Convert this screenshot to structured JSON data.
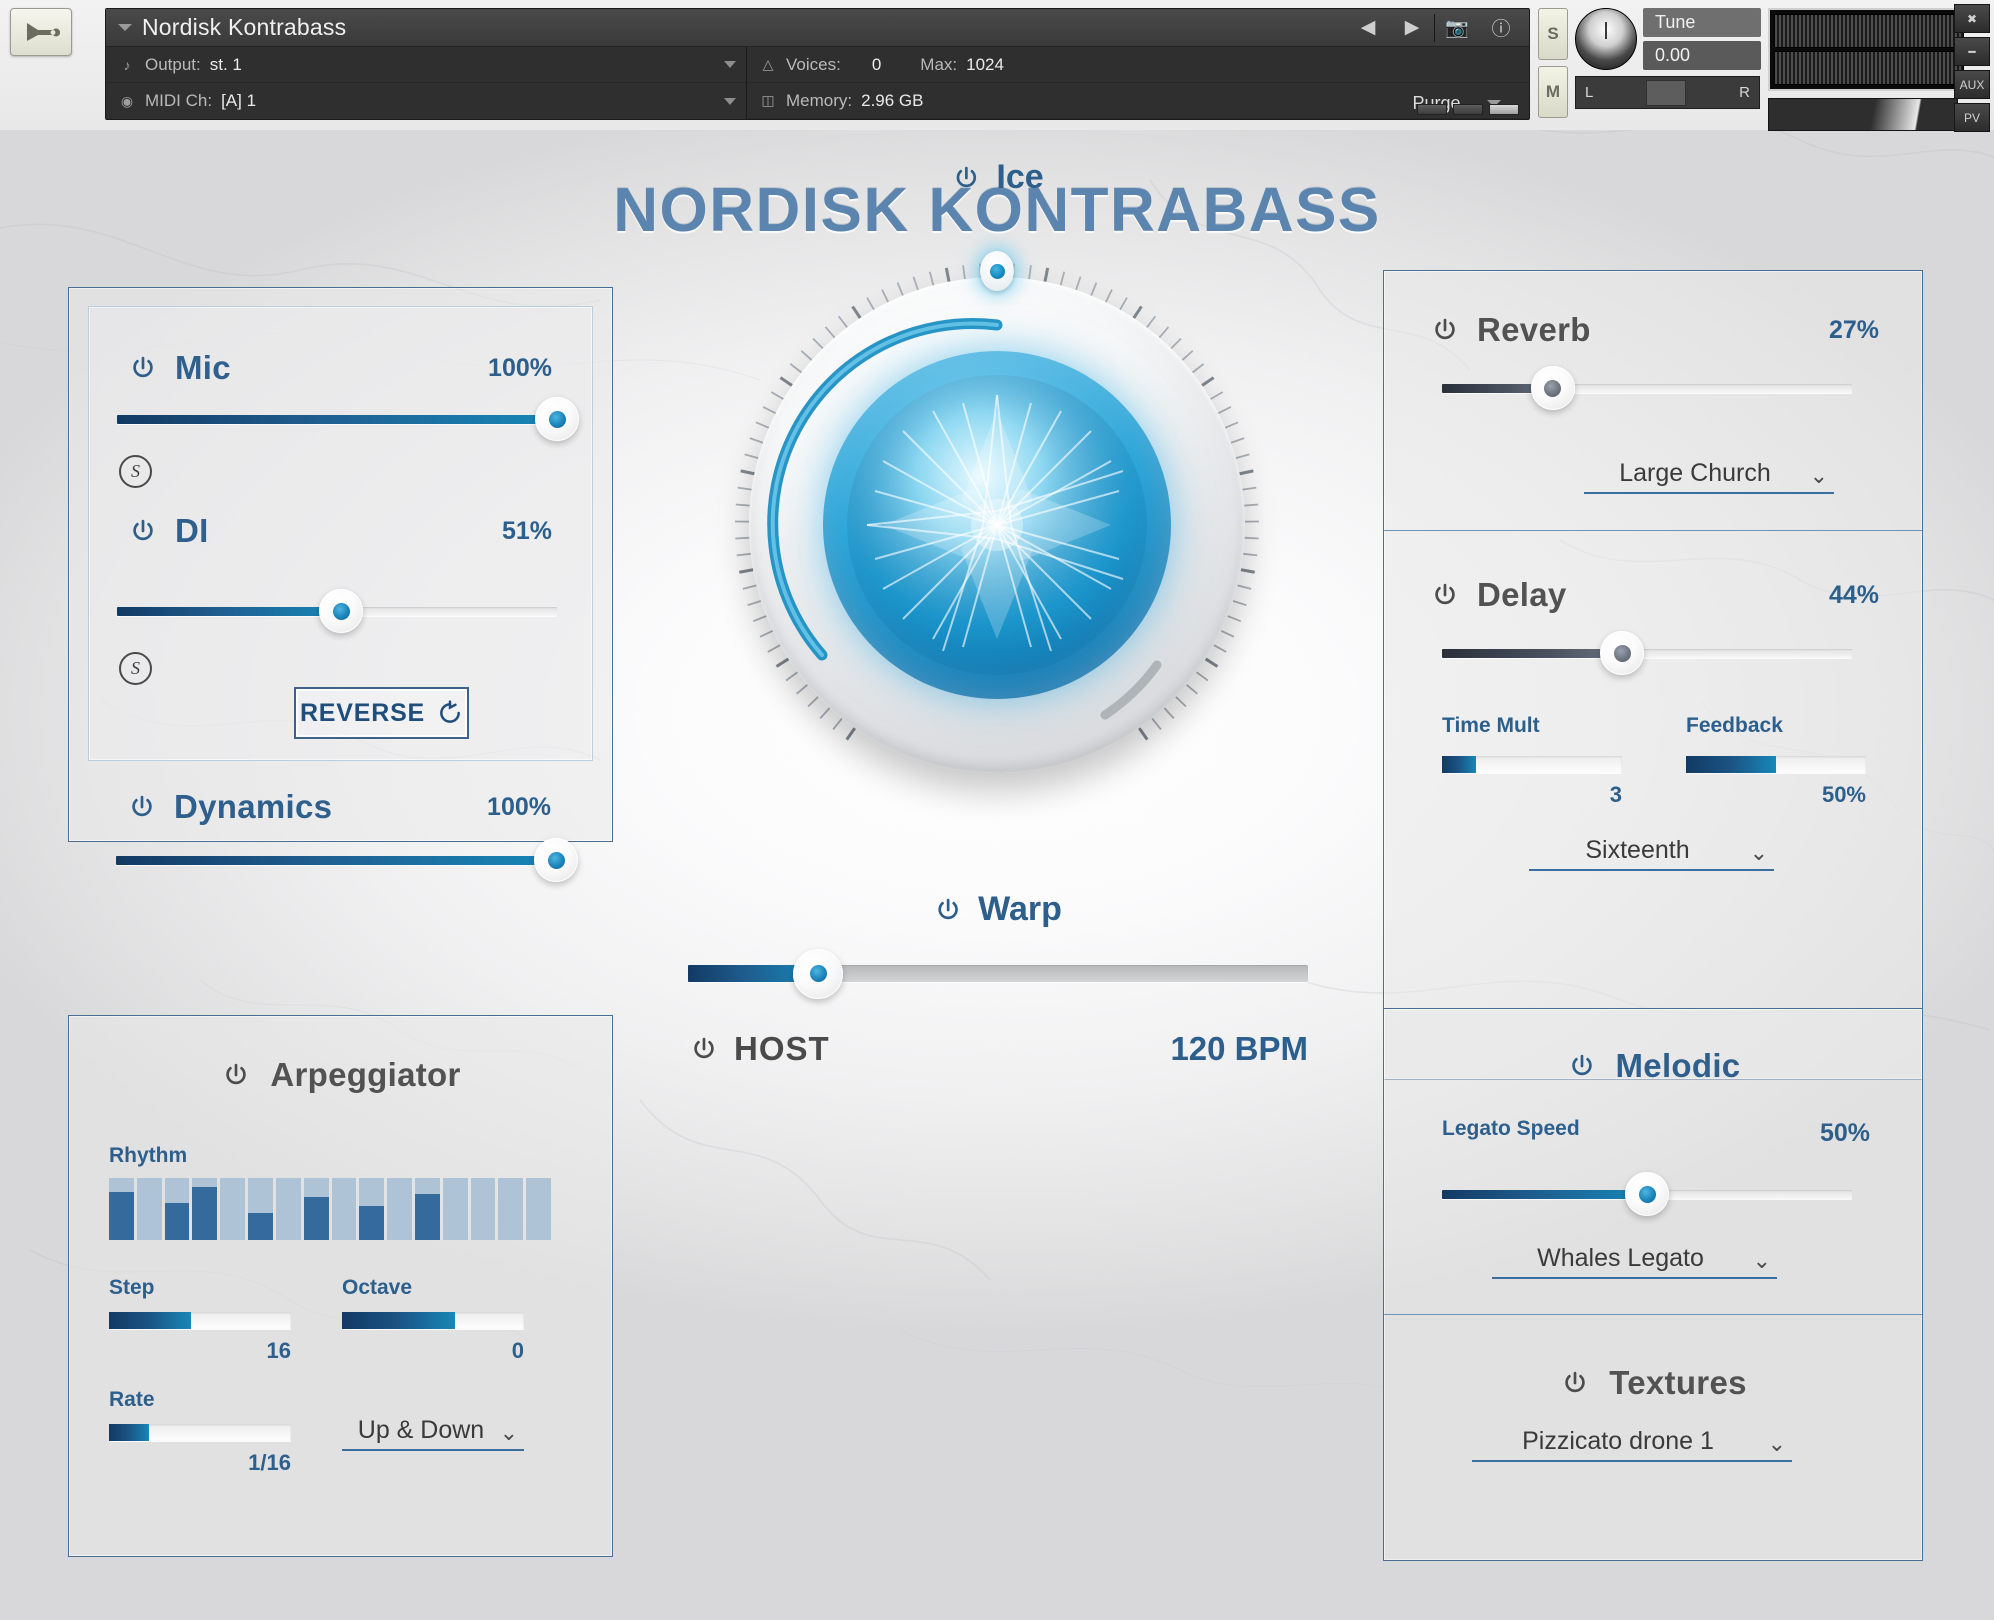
{
  "kontakt": {
    "wrench_icon": "wrench-icon",
    "instrument_name": "Nordisk Kontrabass",
    "output_label": "Output:",
    "output_value": "st. 1",
    "midi_label": "MIDI Ch:",
    "midi_value": "[A] 1",
    "voices_label": "Voices:",
    "voices_value": "0",
    "max_label": "Max:",
    "max_value": "1024",
    "memory_label": "Memory:",
    "memory_value": "2.96 GB",
    "purge_label": "Purge",
    "solo_label": "S",
    "mute_label": "M",
    "tune_label": "Tune",
    "tune_value": "0.00",
    "pan_left": "L",
    "pan_right": "R",
    "aux_label": "AUX",
    "pv_label": "PV"
  },
  "header": {
    "title": "NORDISK KONTRABASS",
    "accent_color": "#5b84ae"
  },
  "mic_panel": {
    "mic": {
      "label": "Mic",
      "value": "100%",
      "fill_pct": 100,
      "solo": "S"
    },
    "di": {
      "label": "DI",
      "value": "51%",
      "fill_pct": 51,
      "solo": "S"
    },
    "reverse": {
      "label": "REVERSE",
      "icon": "rotate-ccw-icon"
    },
    "dynamics": {
      "label": "Dynamics",
      "value": "100%",
      "fill_pct": 100
    }
  },
  "arpeggiator": {
    "title": "Arpeggiator",
    "rhythm_label": "Rhythm",
    "rhythm_steps": [
      78,
      0,
      60,
      85,
      0,
      44,
      0,
      70,
      0,
      55,
      0,
      74,
      0,
      0,
      0,
      0
    ],
    "step": {
      "label": "Step",
      "value": "16",
      "fill_pct": 45
    },
    "octave": {
      "label": "Octave",
      "value": "0",
      "fill_pct": 62
    },
    "rate": {
      "label": "Rate",
      "value": "1/16",
      "fill_pct": 22
    },
    "mode": {
      "value": "Up & Down",
      "chevron": "chevron-down-icon"
    }
  },
  "ice": {
    "label": "Ice",
    "value_pct": 50,
    "power_icon": "power-icon"
  },
  "warp": {
    "label": "Warp",
    "fill_pct": 27,
    "host_label": "HOST",
    "bpm": "120 BPM"
  },
  "reverb": {
    "title": "Reverb",
    "value": "27%",
    "fill_pct": 27,
    "preset": "Large Church",
    "chevron": "chevron-down-icon"
  },
  "delay": {
    "title": "Delay",
    "value": "44%",
    "fill_pct": 44,
    "time_mult": {
      "label": "Time Mult",
      "value": "3",
      "fill_pct": 19
    },
    "feedback": {
      "label": "Feedback",
      "value": "50%",
      "fill_pct": 50
    },
    "sync": {
      "value": "Sixteenth",
      "chevron": "chevron-down-icon"
    }
  },
  "melodic": {
    "title": "Melodic",
    "legato_label": "Legato Speed",
    "legato_value": "50%",
    "legato_fill_pct": 50,
    "preset": "Whales Legato",
    "chevron": "chevron-down-icon"
  },
  "textures": {
    "title": "Textures",
    "preset": "Pizzicato drone 1",
    "chevron": "chevron-down-icon"
  }
}
